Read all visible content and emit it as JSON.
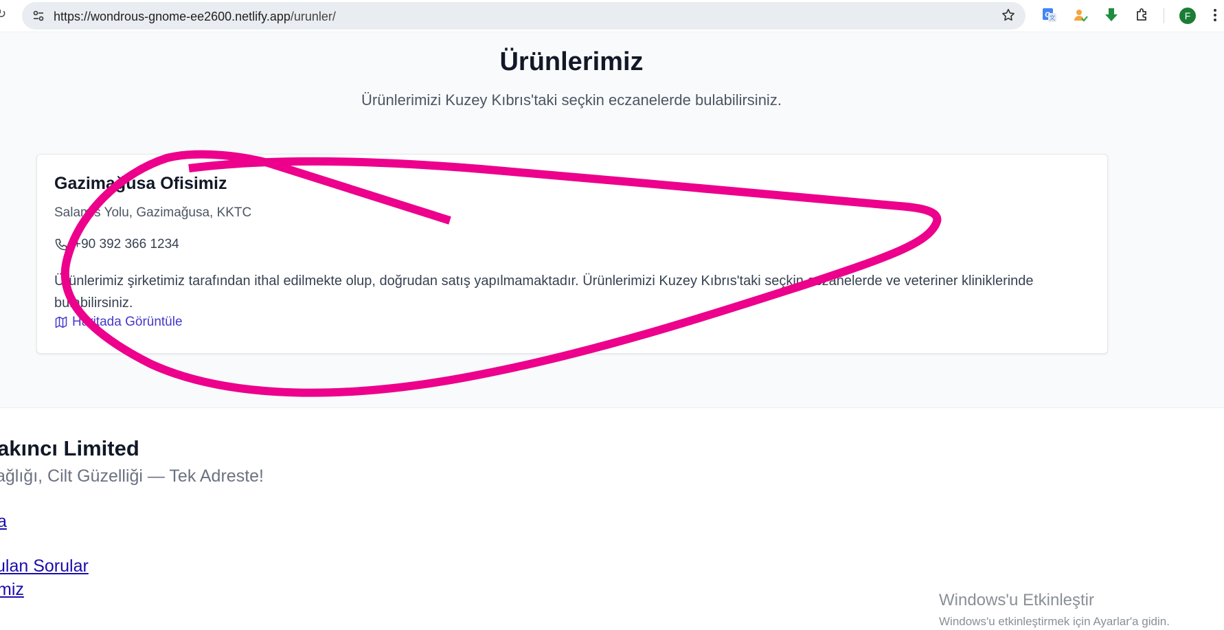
{
  "browser": {
    "url_host": "https://wondrous-gnome-ee2600.netlify.app",
    "url_path": "/urunler/",
    "profile_initial": "F",
    "icons": [
      "reload-icon",
      "site-info-icon",
      "bookmark-star-icon",
      "google-translate-icon",
      "profile-extension-icon",
      "download-icon",
      "extensions-puzzle-icon",
      "menu-kebab-icon"
    ]
  },
  "header": {
    "title": "Ürünlerimiz",
    "subtitle": "Ürünlerimizi Kuzey Kıbrıs'taki seçkin eczanelerde bulabilirsiniz."
  },
  "office": {
    "name": "Gazimağusa Ofisimiz",
    "address": "Salamis Yolu, Gazimağusa, KKTC",
    "phone": "+90 392 366 1234",
    "description": "Ürünlerimiz şirketimiz tarafından ithal edilmekte olup, doğrudan satış yapılmamaktadır. Ürünlerimizi Kuzey Kıbrıs'taki seçkin eczanelerde ve veteriner kliniklerinde bulabilirsiniz.",
    "map_link": "Haritada Görüntüle"
  },
  "footer": {
    "brand": "rakıncı Limited",
    "tagline": "ağlığı, Cilt Güzelliği — Tek Adreste!",
    "links": [
      "a",
      "ulan Sorular",
      "miz"
    ]
  },
  "watermark": {
    "title": "Windows'u Etkinleştir",
    "subtitle": "Windows'u etkinleştirmek için Ayarlar'a gidin."
  },
  "colors": {
    "accent_link": "#4338ca",
    "footer_link": "#1a0dab",
    "scribble": "#ec008c"
  }
}
